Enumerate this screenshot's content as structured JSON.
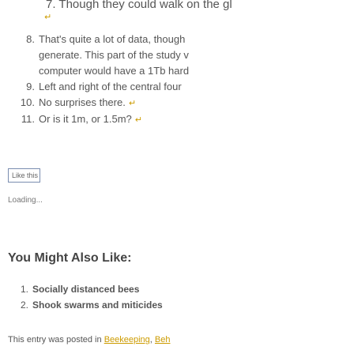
{
  "footnotes": {
    "top_fragment": "7. Though they could walk on the gl",
    "items": [
      {
        "number": "8.",
        "lines": [
          "That's quite a lot of data, though",
          "generate. This part of the study v",
          "computer would have a 1Tb hard"
        ]
      },
      {
        "number": "9.",
        "lines": [
          "Left and right of the central four"
        ]
      },
      {
        "number": "10.",
        "lines": [
          "No surprises there."
        ]
      },
      {
        "number": "11.",
        "lines": [
          "Or is it 1m, or 1.5m?"
        ]
      }
    ],
    "return_symbol": "↵"
  },
  "like_box": {
    "label": "Like this"
  },
  "loading_text": "Loading...",
  "related": {
    "heading": "You Might Also Like:",
    "items": [
      {
        "number": "1.",
        "title": "Socially distanced bees"
      },
      {
        "number": "2.",
        "title": "Shook swarms and miticides"
      }
    ]
  },
  "entry_meta": {
    "prefix": "This entry was posted in",
    "category": "Beekeeping",
    "suffix": "Beh"
  },
  "colors": {
    "link": "#cc9b00",
    "text": "#555555",
    "like_border": "#7a8db0"
  }
}
